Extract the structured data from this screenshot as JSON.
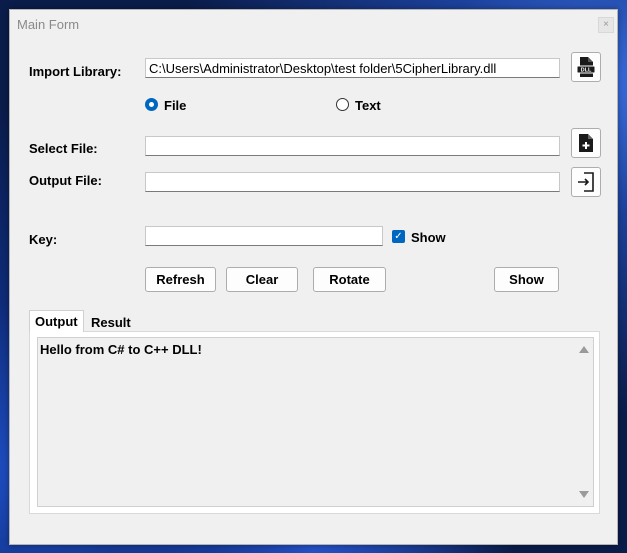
{
  "window": {
    "title": "Main Form",
    "close_symbol": "×"
  },
  "import_library": {
    "label": "Import Library:",
    "value": "C:\\Users\\Administrator\\Desktop\\test folder\\5CipherLibrary.dll",
    "button_icon": "dll-file-icon"
  },
  "mode": {
    "options": [
      {
        "label": "File",
        "checked": true
      },
      {
        "label": "Text",
        "checked": false
      }
    ]
  },
  "select_file": {
    "label": "Select File:",
    "value": "",
    "button_icon": "add-file-icon"
  },
  "output_file": {
    "label": "Output File:",
    "value": "",
    "button_icon": "export-icon"
  },
  "key": {
    "label": "Key:",
    "value": "",
    "show_label": "Show",
    "show_checked": true
  },
  "buttons": {
    "refresh": "Refresh",
    "clear": "Clear",
    "rotate": "Rotate",
    "show": "Show"
  },
  "tabs": [
    {
      "label": "Output",
      "active": true
    },
    {
      "label": "Result",
      "active": false
    }
  ],
  "output_text": "Hello from C# to C++ DLL!",
  "colors": {
    "accent": "#0067c0",
    "window_bg": "#f0f0f0"
  }
}
